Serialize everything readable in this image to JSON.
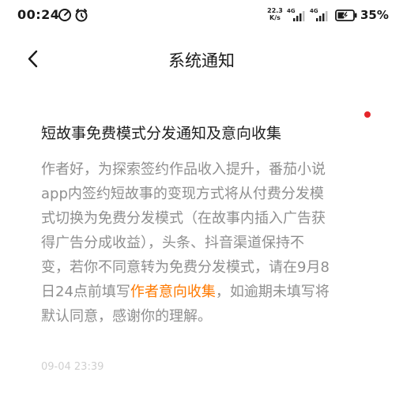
{
  "status_bar": {
    "time": "00:24",
    "net_speed_value": "22.3",
    "net_speed_unit": "K/s",
    "sim1_type": "4G",
    "sim2_type": "4G",
    "battery_percent": "35%",
    "icons": [
      "data-saver-icon",
      "alarm-icon",
      "signal-icon",
      "battery-charging-icon"
    ]
  },
  "nav": {
    "title": "系统通知",
    "back_icon": "chevron-left-icon"
  },
  "notification": {
    "unread": true,
    "title": "短故事免费模式分发通知及意向收集",
    "body_lines": [
      "作者好，为探索签约作品收入提升，番茄小说",
      "app内签约短故事的变现方式将从付费分发模",
      "式切换为免费分发模式（在故事内插入广告获",
      "得广告分成收益），头条、抖音渠道保持不",
      "变，若你不同意转为免费分发模式，请在9月8"
    ],
    "last_line_prefix": "日24点前填写",
    "link_text": "作者意向收集",
    "last_line_suffix": "，如逾期未填写将",
    "final_line": "默认同意，感谢你的理解。",
    "timestamp": "09-04 23:39",
    "link_color": "#ff7a00",
    "dot_color": "#e5252a"
  }
}
